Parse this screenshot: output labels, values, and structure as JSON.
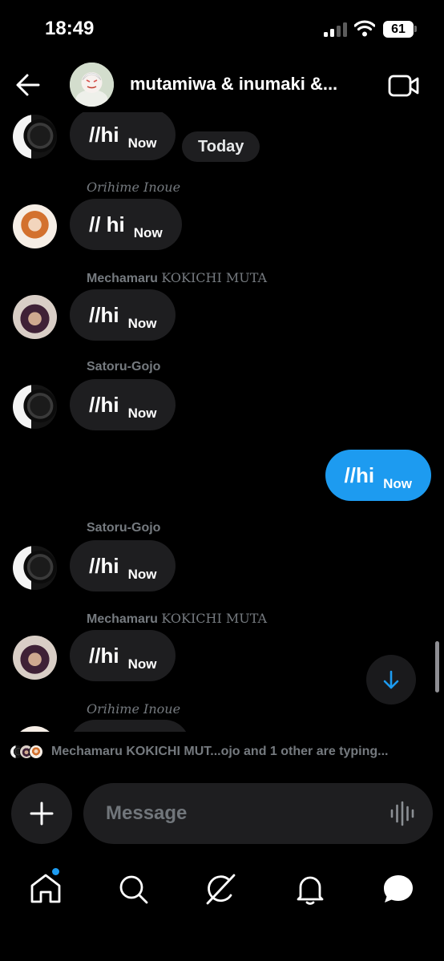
{
  "status_bar": {
    "time": "18:49",
    "battery": "61"
  },
  "header": {
    "title": "mutamiwa & inumaki &..."
  },
  "date_chip": "Today",
  "messages": [
    {
      "sender": "",
      "text": "//hi",
      "time": "Now",
      "avatar": "gojo"
    },
    {
      "sender": "Orihime Inoue",
      "text": "// hi",
      "time": "Now",
      "avatar": "orihime"
    },
    {
      "sender": "Mechamaru KOKICHI MUTA",
      "sender_parts": [
        "Mechamaru",
        "KOKICHI MUTA"
      ],
      "text": "//hi",
      "time": "Now",
      "avatar": "mecha"
    },
    {
      "sender": "Satoru-Gojo",
      "text": "//hi",
      "time": "Now",
      "avatar": "gojo"
    },
    {
      "sender": "me",
      "text": "//hi",
      "time": "Now",
      "outgoing": true
    },
    {
      "sender": "Satoru-Gojo",
      "text": "//hi",
      "time": "Now",
      "avatar": "gojo"
    },
    {
      "sender": "Mechamaru KOKICHI MUTA",
      "sender_parts": [
        "Mechamaru",
        "KOKICHI MUTA"
      ],
      "text": "//hi",
      "time": "Now",
      "avatar": "mecha"
    },
    {
      "sender": "Orihime Inoue",
      "text": "",
      "time": "",
      "avatar": "orihime",
      "partial": true
    }
  ],
  "typing": {
    "text": "Mechamaru KOKICHI MUT...ojo and 1 other are typing...",
    "parts": [
      "Mechamaru",
      " KOKICHI MUT",
      "...ojo and 1 other are typing..."
    ]
  },
  "composer": {
    "placeholder": "Message"
  },
  "icons": {
    "back": "arrow-left-icon",
    "video": "video-camera-icon",
    "scroll_down": "arrow-down-icon",
    "add": "plus-icon",
    "voice": "audio-waveform-icon",
    "nav": [
      "home-icon",
      "search-icon",
      "grok-icon",
      "bell-icon",
      "messages-icon"
    ]
  },
  "colors": {
    "accent": "#1d9bf0",
    "bubble": "#1e1e20",
    "background": "#000000",
    "muted": "#757a7f"
  }
}
